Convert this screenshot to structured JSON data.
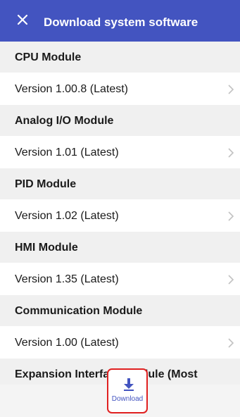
{
  "header": {
    "title": "Download system software",
    "background": "#4354c0",
    "close_icon": "close-icon"
  },
  "modules": [
    {
      "name": "CPU Module",
      "version": "Version 1.00.8 (Latest)"
    },
    {
      "name": "Analog I/O Module",
      "version": "Version 1.01 (Latest)"
    },
    {
      "name": "PID Module",
      "version": "Version 1.02 (Latest)"
    },
    {
      "name": "HMI Module",
      "version": "Version 1.35 (Latest)"
    },
    {
      "name": "Communication Module",
      "version": "Version 1.00 (Latest)"
    },
    {
      "name": "Expansion Interface Module (Most",
      "version": ""
    }
  ],
  "footer": {
    "download_label": "Download",
    "download_icon": "download-icon",
    "highlight_color": "#e02020"
  },
  "row_icon": "chevron-right-icon"
}
